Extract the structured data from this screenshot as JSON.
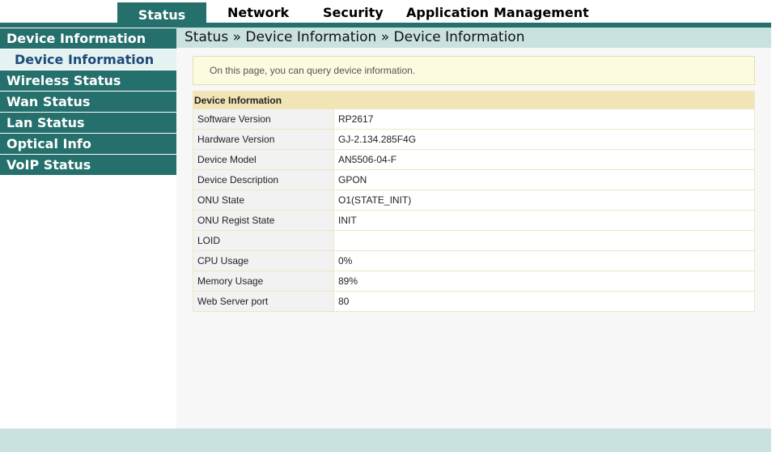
{
  "nav": {
    "tabs": [
      "Status",
      "Network",
      "Security",
      "Application",
      "Management"
    ],
    "active": "Status"
  },
  "sidebar": {
    "items": [
      {
        "label": "Device Information"
      },
      {
        "label": "Device Information"
      },
      {
        "label": "Wireless Status"
      },
      {
        "label": "Wan Status"
      },
      {
        "label": "Lan Status"
      },
      {
        "label": "Optical Info"
      },
      {
        "label": "VoIP Status"
      }
    ]
  },
  "breadcrumb": "Status » Device Information » Device Information",
  "notice": "On this page, you can query device information.",
  "table": {
    "header": "Device Information",
    "rows": [
      {
        "label": "Software Version",
        "value": "RP2617"
      },
      {
        "label": "Hardware Version",
        "value": "GJ-2.134.285F4G"
      },
      {
        "label": "Device Model",
        "value": "AN5506-04-F"
      },
      {
        "label": "Device Description",
        "value": "GPON"
      },
      {
        "label": "ONU State",
        "value": "O1(STATE_INIT)"
      },
      {
        "label": "ONU Regist State",
        "value": "INIT"
      },
      {
        "label": "LOID",
        "value": ""
      },
      {
        "label": "CPU Usage",
        "value": "0%"
      },
      {
        "label": "Memory Usage",
        "value": "89%"
      },
      {
        "label": "Web Server port",
        "value": "80"
      }
    ]
  },
  "colors": {
    "accent": "#25706c",
    "breadcrumb_bg": "#c9e2e0",
    "notice_bg": "#fcfbe0",
    "table_header_bg": "#f1e5b6"
  }
}
